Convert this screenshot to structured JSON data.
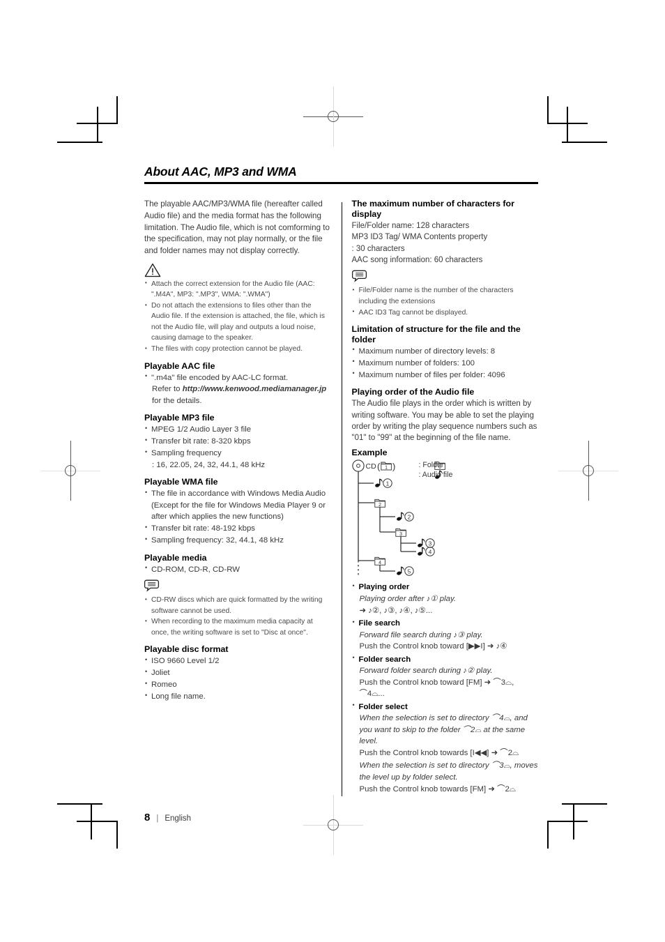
{
  "page": {
    "title": "About AAC, MP3 and WMA",
    "number": "8",
    "language": "English",
    "separator": "|"
  },
  "left": {
    "intro": "The playable AAC/MP3/WMA file (hereafter called Audio file) and the media format has the following limitation. The Audio file, which is not comforming to the specification, may not play normally, or the file and folder names may not display correctly.",
    "warning_icon": "warning-triangle-icon",
    "warnings": [
      "Attach the correct extension for the Audio file (AAC: \".M4A\", MP3: \".MP3\", WMA: \".WMA\")",
      "Do not attach the extensions to files other than the Audio file. If the extension is attached, the file, which is not the Audio file, will play and outputs a loud noise, causing damage to the speaker.",
      "The files with copy protection cannot be played."
    ],
    "aac": {
      "heading": "Playable AAC file",
      "item_pre": "\".m4a\" file encoded by AAC-LC format.",
      "item_refer": "Refer to",
      "item_url": "http://www.kenwood.mediamanager.jp",
      "item_post": "for the details."
    },
    "mp3": {
      "heading": "Playable MP3 file",
      "items": [
        "MPEG 1/2 Audio Layer 3 file",
        "Transfer bit rate: 8-320 kbps",
        "Sampling frequency"
      ],
      "freq_line": ": 16, 22.05, 24, 32, 44.1, 48 kHz"
    },
    "wma": {
      "heading": "Playable WMA file",
      "items": [
        "The file in accordance with Windows Media Audio (Except for the file for Windows Media Player 9 or after which applies the new functions)",
        "Transfer bit rate: 48-192 kbps",
        "Sampling frequency: 32, 44.1, 48 kHz"
      ]
    },
    "media": {
      "heading": "Playable media",
      "items": [
        "CD-ROM, CD-R, CD-RW"
      ],
      "note_icon": "note-bubble-icon",
      "notes": [
        "CD-RW discs which are quick formatted by the writing software cannot be used.",
        "When recording to the maximum media capacity at once, the writing software is set to \"Disc at once\"."
      ]
    },
    "disc_format": {
      "heading": "Playable disc format",
      "items": [
        "ISO 9660 Level 1/2",
        "Joliet",
        "Romeo",
        "Long file name."
      ]
    }
  },
  "right": {
    "max_chars": {
      "heading": "The maximum number of characters for display",
      "lines": [
        "File/Folder name: 128 characters",
        "MP3 ID3 Tag/ WMA Contents property",
        ": 30 characters",
        "AAC song information: 60 characters"
      ],
      "note_icon": "note-bubble-icon",
      "notes": [
        "File/Folder name is the number of the characters including the extensions",
        "AAC ID3 Tag cannot be displayed."
      ]
    },
    "limitation": {
      "heading": "Limitation of structure for the file and the folder",
      "items": [
        "Maximum number of directory levels: 8",
        "Maximum number of folders: 100",
        "Maximum number of files per folder: 4096"
      ]
    },
    "playing_order": {
      "heading": "Playing order of the Audio file",
      "body": "The Audio file plays in the order which is written by writing software. You may be able to set the playing order by writing the play sequence numbers such as \"01\" to \"99\" at the beginning of the file name.",
      "example_label": "Example"
    },
    "diagram": {
      "root_label": "CD",
      "root_folder": "1",
      "legend_folder": ": Folder",
      "legend_folder_box": "0",
      "legend_audio": ": Audio file",
      "nodes": [
        {
          "type": "audio",
          "num": "1"
        },
        {
          "type": "folder",
          "num": "2"
        },
        {
          "type": "audio",
          "num": "2"
        },
        {
          "type": "folder",
          "num": "3"
        },
        {
          "type": "audio",
          "num": "3"
        },
        {
          "type": "audio",
          "num": "4"
        },
        {
          "type": "folder",
          "num": "4"
        },
        {
          "type": "audio",
          "num": "5"
        }
      ]
    },
    "operations": [
      {
        "label": "Playing order",
        "italic": "Playing order after ♪① play.",
        "result": "➜ ♪②, ♪③, ♪④, ♪⑤..."
      },
      {
        "label": "File search",
        "italic": "Forward file search during ♪③ play.",
        "result": "Push the Control knob toward [▶▶I] ➜ ♪④"
      },
      {
        "label": "Folder search",
        "italic": "Forward folder search during ♪② play.",
        "result": "Push the Control knob toward [FM] ➜ ⌒3⌓, ⌒4⌓..."
      },
      {
        "label": "Folder select",
        "italic": "When the selection is set to directory ⌒4⌓, and you want to skip to the folder ⌒2⌓ at the same level.",
        "result": "Push the Control knob towards [I◀◀] ➜ ⌒2⌓",
        "italic2": "When the selection is set to directory ⌒3⌓, moves the level up by folder select.",
        "result2": "Push the Control knob towards [FM] ➜ ⌒2⌓"
      }
    ]
  }
}
